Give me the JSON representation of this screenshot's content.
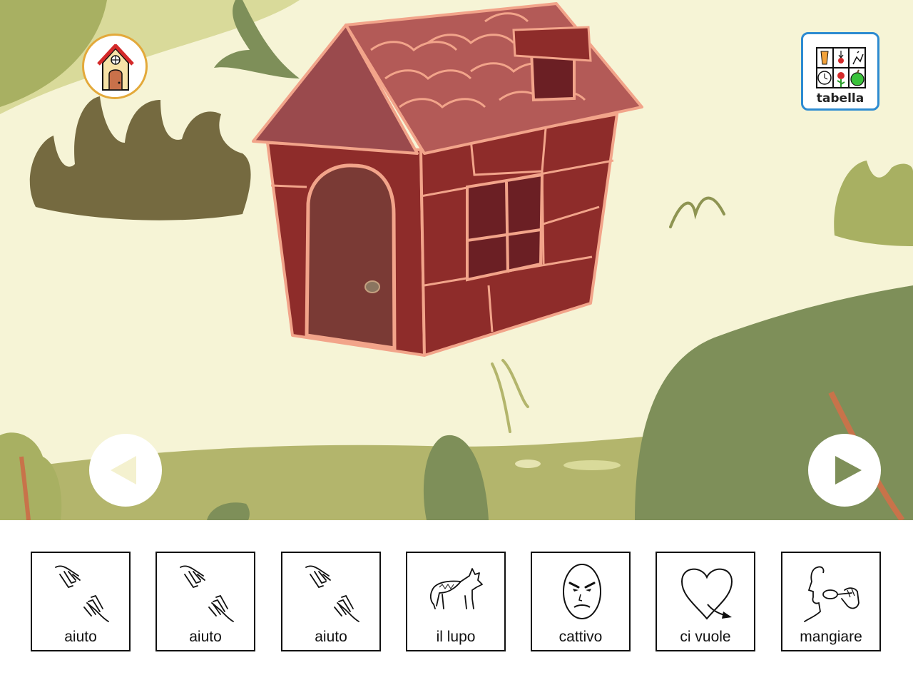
{
  "scene": {
    "home_icon": "house-icon",
    "table_button": {
      "label": "tabella",
      "icon": "symbol-grid-icon"
    },
    "nav": {
      "previous": "triangle-left-icon",
      "next": "triangle-right-icon"
    },
    "colors": {
      "sky": "#f6f4d6",
      "hill_light": "#b3b56c",
      "bush_dark": "#756a40",
      "bush_green": "#7e8f59",
      "house_wall": "#8e2c2a",
      "house_roof": "#b35a57",
      "house_outline": "#f2a48a"
    }
  },
  "sentence_strip": {
    "cards": [
      {
        "label": "aiuto",
        "icon": "helping-hands-icon"
      },
      {
        "label": "aiuto",
        "icon": "helping-hands-icon"
      },
      {
        "label": "aiuto",
        "icon": "helping-hands-icon"
      },
      {
        "label": "il lupo",
        "icon": "wolf-icon"
      },
      {
        "label": "cattivo",
        "icon": "angry-face-icon"
      },
      {
        "label": "ci vuole",
        "icon": "heart-arrow-icon"
      },
      {
        "label": "mangiare",
        "icon": "eating-icon"
      }
    ]
  }
}
